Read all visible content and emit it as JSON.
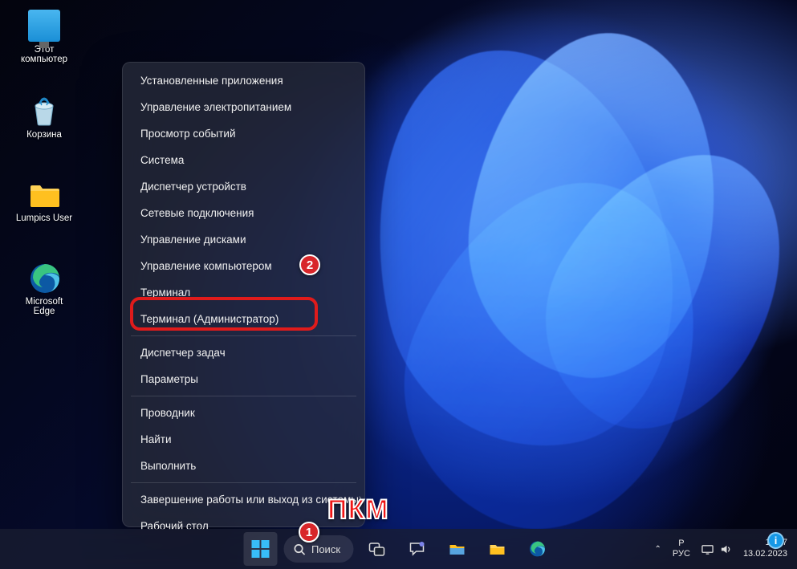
{
  "desktop": {
    "icons": [
      {
        "name": "this-pc",
        "label": "Этот\nкомпьютер"
      },
      {
        "name": "recycle",
        "label": "Корзина"
      },
      {
        "name": "userfolder",
        "label": "Lumpics User"
      },
      {
        "name": "edge",
        "label": "Microsoft\nEdge"
      }
    ]
  },
  "winx_menu": {
    "groups": [
      [
        "Установленные приложения",
        "Управление электропитанием",
        "Просмотр событий",
        "Система",
        "Диспетчер устройств",
        "Сетевые подключения",
        "Управление дисками",
        "Управление компьютером",
        "Терминал",
        "Терминал (Администратор)"
      ],
      [
        "Диспетчер задач",
        "Параметры"
      ],
      [
        "Проводник",
        "Найти",
        "Выполнить"
      ],
      [
        {
          "label": "Завершение работы или выход из системы",
          "submenu": true
        },
        "Рабочий стол"
      ]
    ],
    "highlighted_index": 9
  },
  "taskbar": {
    "search_label": "Поиск",
    "lang_top": "Р",
    "lang_bottom": "РУС",
    "time": "16:47",
    "date": "13.02.2023"
  },
  "annotations": {
    "callout1": "1",
    "callout2": "2",
    "rmb_label": "ПКМ",
    "info": "i"
  }
}
